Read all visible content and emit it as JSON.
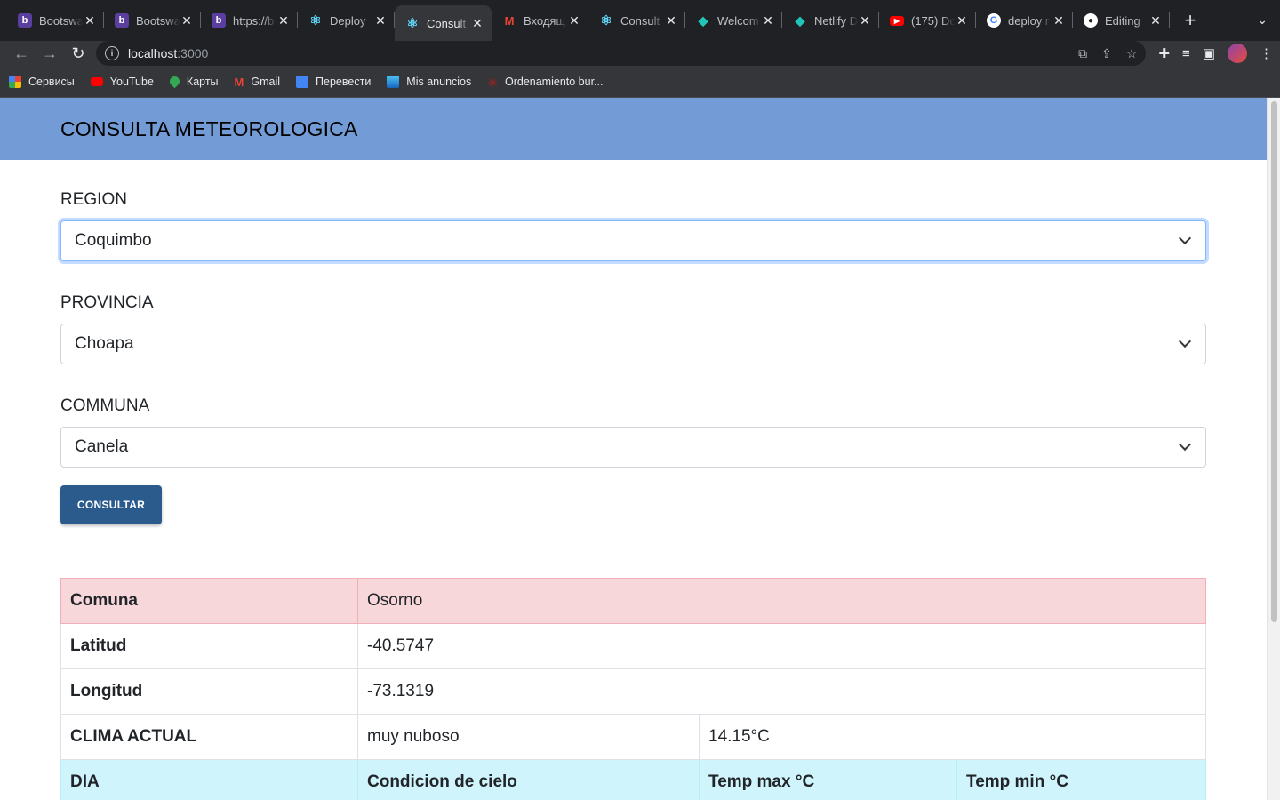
{
  "browser": {
    "tabs": [
      {
        "title": "Bootswa",
        "icon": "bootstrap-icon",
        "active": false
      },
      {
        "title": "Bootswa",
        "icon": "bootstrap-icon",
        "active": false
      },
      {
        "title": "https://b",
        "icon": "bootstrap-icon",
        "active": false
      },
      {
        "title": "Deploy",
        "icon": "react-icon",
        "active": false
      },
      {
        "title": "Consult",
        "icon": "react-icon",
        "active": true
      },
      {
        "title": "Входящ",
        "icon": "gmail-icon",
        "active": false
      },
      {
        "title": "Consult",
        "icon": "react-icon",
        "active": false
      },
      {
        "title": "Welcom",
        "icon": "netlify-icon",
        "active": false
      },
      {
        "title": "Netlify D",
        "icon": "netlify-icon",
        "active": false
      },
      {
        "title": "(175) Dc",
        "icon": "youtube-icon",
        "active": false
      },
      {
        "title": "deploy r",
        "icon": "google-icon",
        "active": false
      },
      {
        "title": "Editing",
        "icon": "github-icon",
        "active": false
      }
    ],
    "url_host": "localhost",
    "url_port": ":3000",
    "bookmarks": [
      {
        "label": "Сервисы",
        "color": "#4285f4"
      },
      {
        "label": "YouTube",
        "color": "#ff0000"
      },
      {
        "label": "Карты",
        "color": "#34a853"
      },
      {
        "label": "Gmail",
        "color": "#ea4335"
      },
      {
        "label": "Перевести",
        "color": "#4285f4"
      },
      {
        "label": "Mis anuncios",
        "color": "#2a7ab8"
      },
      {
        "label": "Ordenamiento bur...",
        "color": "#b71c1c"
      }
    ]
  },
  "page": {
    "title": "CONSULTA METEOROLOGICA",
    "region": {
      "label": "REGION",
      "value": "Coquimbo"
    },
    "provincia": {
      "label": "PROVINCIA",
      "value": "Choapa"
    },
    "comuna": {
      "label": "COMMUNA",
      "value": "Canela"
    },
    "button": "CONSULTAR",
    "result": {
      "comuna_label": "Comuna",
      "comuna_value": "Osorno",
      "latitud_label": "Latitud",
      "latitud_value": "-40.5747",
      "longitud_label": "Longitud",
      "longitud_value": "-73.1319",
      "clima_label": "CLIMA ACTUAL",
      "clima_desc": "muy nuboso",
      "clima_temp": "14.15°C",
      "forecast_headers": [
        "DIA",
        "Condicion de cielo",
        "Temp max °C",
        "Temp min °C"
      ]
    }
  },
  "colors": {
    "header_bg": "#739cd7",
    "button_bg": "#2b5b8d",
    "row_pink": "#f8d7da",
    "row_cyan": "#cff4fc"
  }
}
